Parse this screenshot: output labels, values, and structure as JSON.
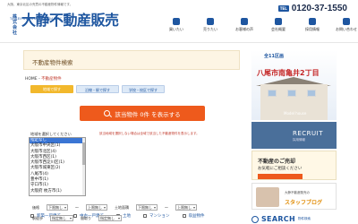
{
  "header": {
    "tagline": "大阪、東京北区の売買の不動産物件情報です。",
    "logo_small": "株式会社",
    "logo_main": "大静不動産販売",
    "logo_sub": "TAISEIFUDOUSANHANBAI.INC",
    "phone_badge": "TEL",
    "phone": "0120-37-1550",
    "nav": [
      "買いたい",
      "売りたい",
      "お客様の声",
      "会社概要",
      "採用情報",
      "お問い合わせ"
    ]
  },
  "panel": {
    "title": "不動産物件検索",
    "breadcrumb_home": "HOME",
    "breadcrumb_sep": " - ",
    "breadcrumb_current": "不動産物件",
    "tabs": [
      "地域で探す",
      "沿線・駅で探す",
      "学校・校区で探す"
    ],
    "search_button": "該当物件 0件 を表示する",
    "area_label": "地域を選択してください",
    "notice": "該当地域を選択しない場合は全域で該当した不動産物件を表示します。",
    "areas": [
      "指定なし",
      "大阪市中央区(1)",
      "大阪市北区(4)",
      "大阪市西区(1)",
      "大阪市西淀川区(1)",
      "大阪市城東区(2)",
      "八尾市(4)",
      "豊中市(1)",
      "守口市(1)",
      "大阪府 枚方市(1)"
    ],
    "checks": [
      "新築一戸建て",
      "中古一戸建て",
      "土地",
      "マンション",
      "収益物件"
    ],
    "price_label": "価格",
    "price_from": "下限無し",
    "price_to": "上限無し",
    "price_sep": "～",
    "area_sep": "～",
    "land_label": "土地面積",
    "land_from": "下限無し",
    "land_to": "上限無し",
    "walk_label": "駅徒歩",
    "walk_value": "指定無し",
    "layout_label": "間取り",
    "layout_value": "指定無し"
  },
  "side": {
    "ad1_top": "全11区画",
    "ad1_main": "八尾市南亀井2丁目",
    "ad1_caption": "Model house",
    "ad2_title": "RECRUIT",
    "ad2_sub": "採用情報",
    "ad3_t1": "不動産のご売却",
    "ad3_t2": "お気軽にご相談ください",
    "ad4_t1": "大静不動産販売の",
    "ad4_t2": "スタッフブログ",
    "ad5_title": "SEARCH",
    "ad5_sub": "物件検索"
  }
}
